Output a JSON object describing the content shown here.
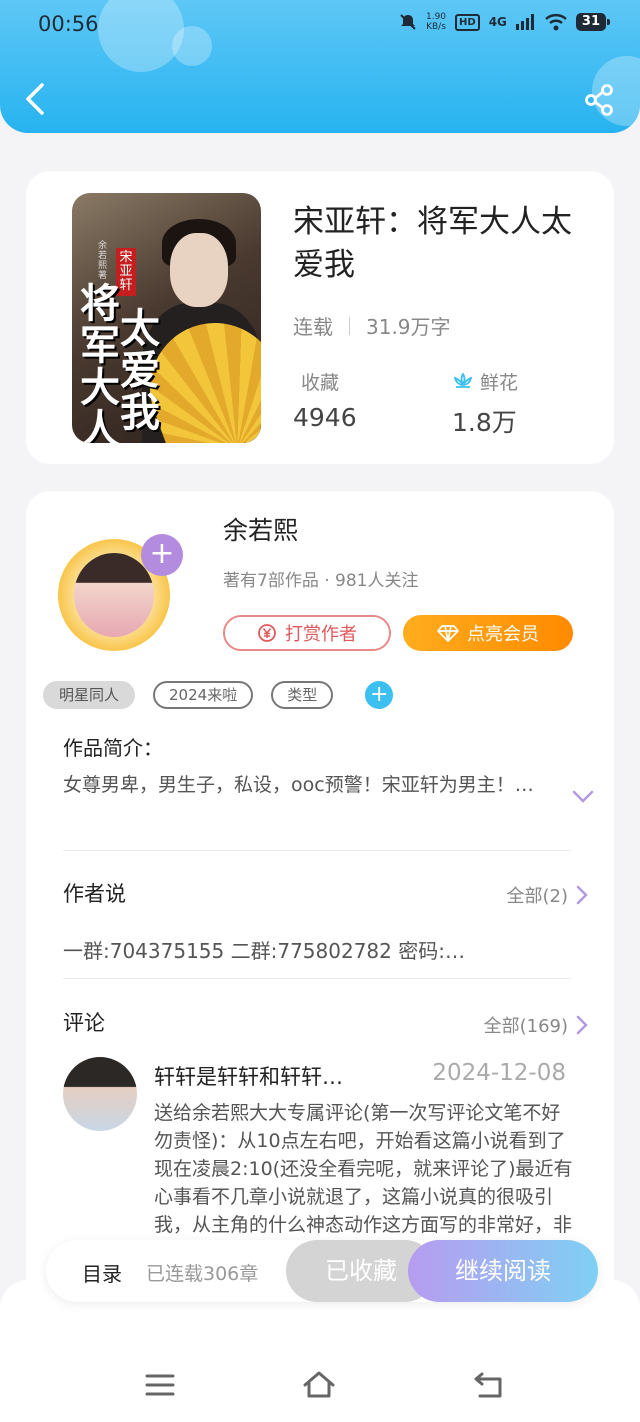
{
  "status": {
    "time": "00:56",
    "speed": "1.90",
    "speed_unit": "KB/s",
    "hd": "HD",
    "network": "4G",
    "battery": "31"
  },
  "book": {
    "title": "宋亚轩：将军大人太爱我",
    "cover_title_a": "将军大人",
    "cover_title_b": "太爱我",
    "cover_tag": "宋亚轩",
    "cover_author": "余若熙著",
    "status": "连载",
    "word_count": "31.9万字",
    "favorites_label": "收藏",
    "favorites_value": "4946",
    "flowers_label": "鲜花",
    "flowers_value": "1.8万"
  },
  "author": {
    "name": "余若熙",
    "stats": "著有7部作品 · 981人关注",
    "reward_label": "打赏作者",
    "vip_label": "点亮会员"
  },
  "tags": [
    "明星同人",
    "2024来啦",
    "类型"
  ],
  "intro": {
    "title": "作品简介：",
    "text": "女尊男卑，男生子，私设，ooc预警！宋亚轩为男主！…"
  },
  "author_notes": {
    "title": "作者说",
    "all_label": "全部(2)",
    "text": "一群:704375155 二群:775802782 密码:…"
  },
  "comments": {
    "title": "评论",
    "all_label": "全部(169)",
    "user": "轩轩是轩轩和轩轩…",
    "date": "2024-12-08",
    "body": "送给余若熙大大专属评论(第一次写评论文笔不好勿责怪)：从10点左右吧，开始看这篇小说看到了现在凌晨2:10(还没全看完呢，就来评论了)最近有心事看不几章小说就退了，这篇小说真的很吸引我，从主角的什么神态动作这方面写的非常好，非常细腻，特别吸"
  },
  "action_bar": {
    "toc_label": "目录",
    "chapter_count": "已连载306章",
    "collected_label": "已收藏",
    "read_label": "继续阅读"
  },
  "colors": {
    "header": "#27b3f0",
    "accent_orange": "#ff8a00",
    "accent_purple": "#b79cf0",
    "reward_red": "#e0595b"
  }
}
